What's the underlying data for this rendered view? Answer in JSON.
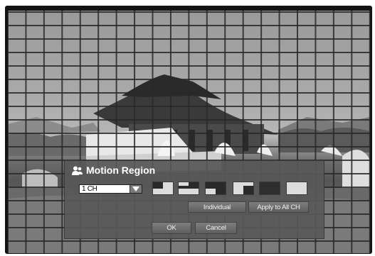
{
  "dialog": {
    "title": "Motion Region",
    "title_icon": "person-icon",
    "channel_select": {
      "value": "1 CH"
    },
    "presets": [
      "top-left-quadrant",
      "top-right-corner",
      "bottom-right-quadrant",
      "bottom-right-corner",
      "full-dark",
      "empty"
    ],
    "individual_label": "Individual",
    "apply_all_label": "Apply to All CH",
    "ok_label": "OK",
    "cancel_label": "Cancel"
  },
  "colors": {
    "grid_line": "#282828",
    "dialog_bg": "#585858",
    "button_bg": "#6e6e6e",
    "title_text": "#ffffff"
  }
}
